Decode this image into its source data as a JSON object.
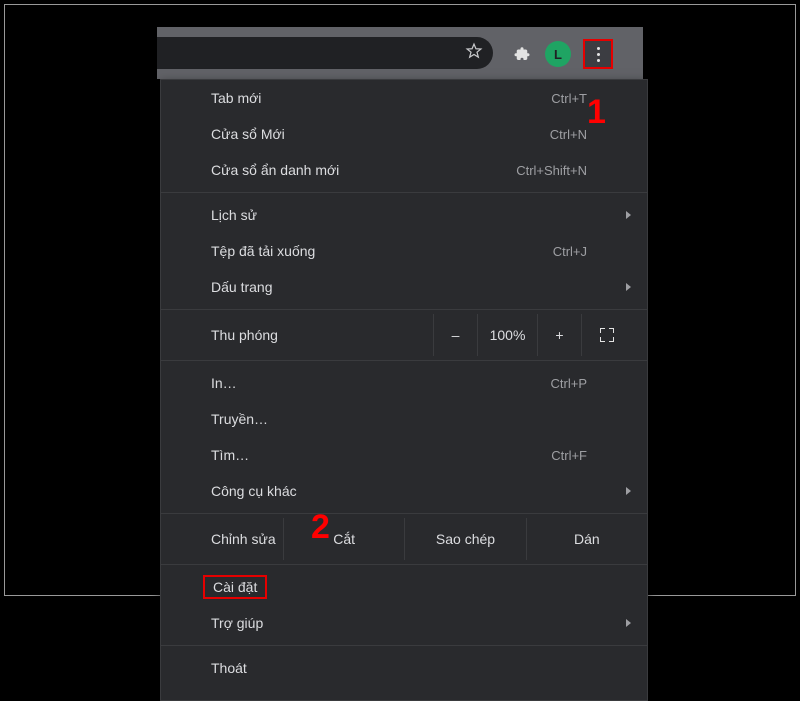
{
  "toolbar": {
    "avatar_letter": "L"
  },
  "menu": {
    "new_tab": {
      "label": "Tab mới",
      "shortcut": "Ctrl+T"
    },
    "new_window": {
      "label": "Cửa sổ Mới",
      "shortcut": "Ctrl+N"
    },
    "incognito": {
      "label": "Cửa sổ ẩn danh mới",
      "shortcut": "Ctrl+Shift+N"
    },
    "history": {
      "label": "Lịch sử"
    },
    "downloads": {
      "label": "Tệp đã tải xuống",
      "shortcut": "Ctrl+J"
    },
    "bookmarks": {
      "label": "Dấu trang"
    },
    "zoom": {
      "label": "Thu phóng",
      "minus": "–",
      "value": "100%",
      "plus": "+"
    },
    "print": {
      "label": "In…",
      "shortcut": "Ctrl+P"
    },
    "cast": {
      "label": "Truyền…"
    },
    "find": {
      "label": "Tìm…",
      "shortcut": "Ctrl+F"
    },
    "more_tools": {
      "label": "Công cụ khác"
    },
    "edit": {
      "label": "Chỉnh sửa",
      "cut": "Cắt",
      "copy": "Sao chép",
      "paste": "Dán"
    },
    "settings": {
      "label": "Cài đặt"
    },
    "help": {
      "label": "Trợ giúp"
    },
    "exit": {
      "label": "Thoát"
    }
  },
  "annotations": {
    "step1": "1",
    "step2": "2"
  },
  "colors": {
    "highlight": "#e60000",
    "menu_bg": "#292a2d",
    "avatar_bg": "#1fa463"
  }
}
